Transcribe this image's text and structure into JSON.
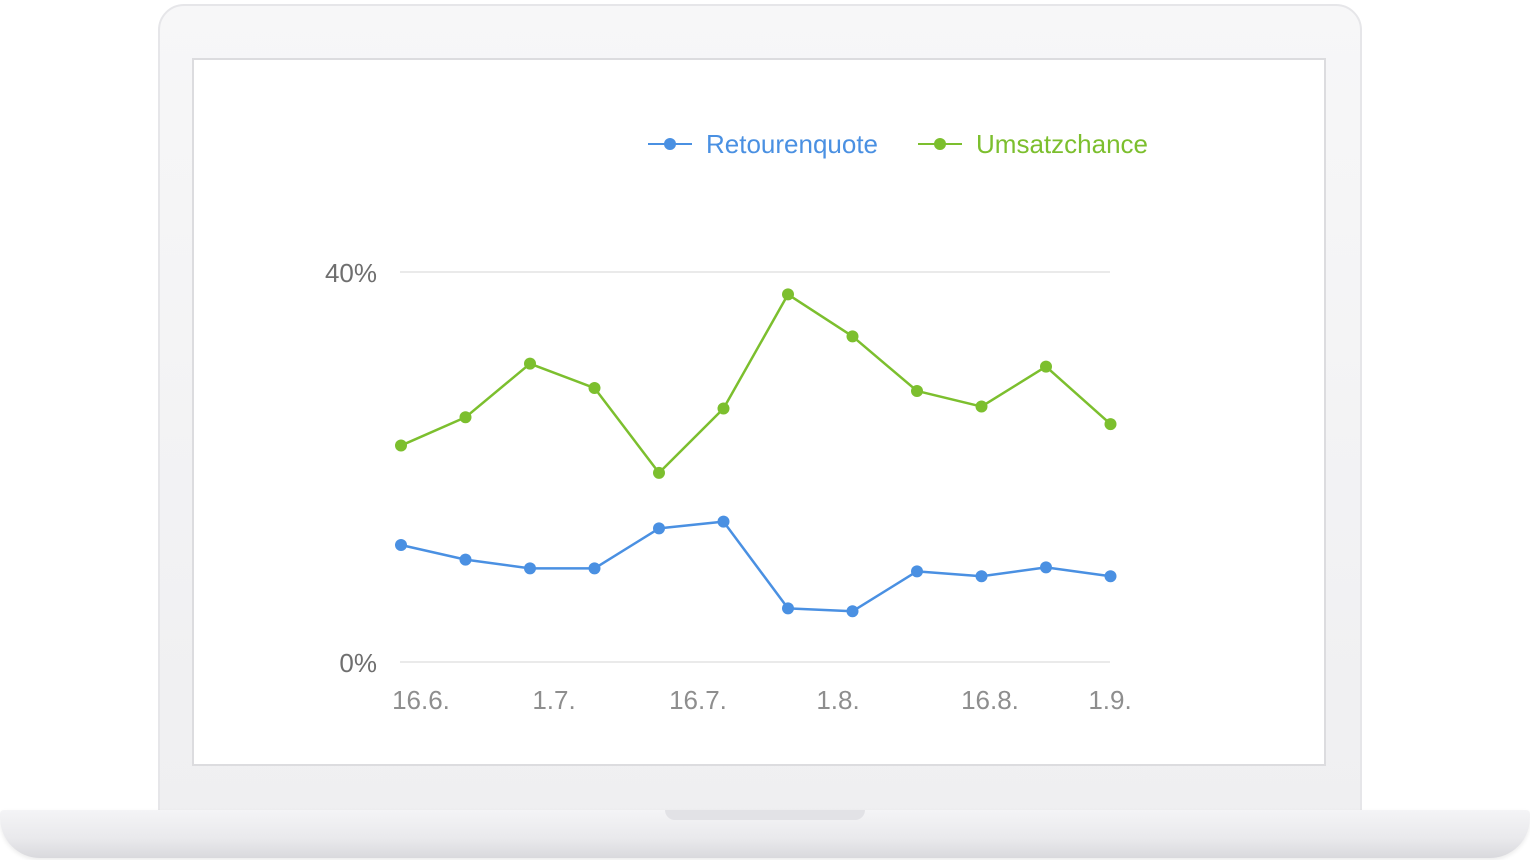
{
  "colors": {
    "retourenquote": "#4a90e2",
    "umsatzchance": "#7cbf2e",
    "grid": "#e4e4e4",
    "tick": "#8e8e8e"
  },
  "legend": [
    {
      "label": "Retourenquote",
      "color": "#4a90e2"
    },
    {
      "label": "Umsatzchance",
      "color": "#7cbf2e"
    }
  ],
  "chart_data": {
    "type": "line",
    "title": "",
    "xlabel": "",
    "ylabel": "",
    "ylim": [
      0,
      40
    ],
    "y_ticks": [
      "0%",
      "40%"
    ],
    "x_tick_labels": [
      "16.6.",
      "1.7.",
      "16.7.",
      "1.8.",
      "16.8.",
      "1.9."
    ],
    "legend_position": "top-right",
    "grid": true,
    "x": [
      "16.6.",
      "21.6.",
      "26.6.",
      "1.7.",
      "6.7.",
      "11.7.",
      "16.7.",
      "21.7.",
      "26.7.",
      "31.7.",
      "5.8.",
      "10.8."
    ],
    "series": [
      {
        "name": "Retourenquote",
        "color": "#4a90e2",
        "values": [
          12.0,
          10.5,
          9.6,
          9.6,
          13.7,
          14.4,
          5.5,
          5.2,
          9.3,
          8.8,
          9.7,
          8.8
        ]
      },
      {
        "name": "Umsatzchance",
        "color": "#7cbf2e",
        "values": [
          22.2,
          25.1,
          30.6,
          28.1,
          19.4,
          26.0,
          37.7,
          33.4,
          27.8,
          26.2,
          30.3,
          24.4
        ]
      }
    ]
  }
}
